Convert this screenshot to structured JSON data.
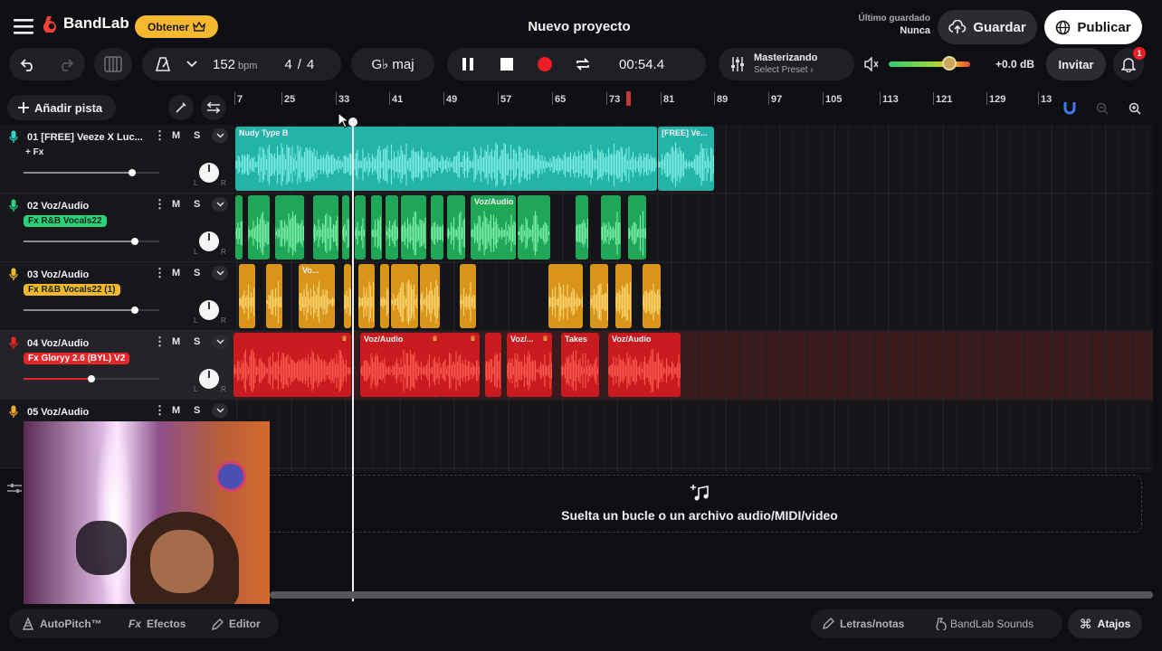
{
  "header": {
    "brand": "BandLab",
    "get_button": "Obtener",
    "project_title": "Nuevo proyecto",
    "last_saved_label": "Último guardado",
    "last_saved_value": "Nunca",
    "save_button": "Guardar",
    "publish_button": "Publicar"
  },
  "transport": {
    "tempo": "152",
    "tempo_unit": "bpm",
    "time_sig_num": "4",
    "time_sig_sep": "/",
    "time_sig_den": "4",
    "key": "G♭ maj",
    "time": "00:54.4",
    "mastering_title": "Masterizando",
    "mastering_sub": "Select Preset ›",
    "volume_db": "+0.0 dB",
    "invite_button": "Invitar",
    "notification_count": "1",
    "volume_level": 0.74
  },
  "toolbar": {
    "add_track": "Añadir pista"
  },
  "ruler": {
    "marks": [
      "7",
      "25",
      "33",
      "41",
      "49",
      "57",
      "65",
      "73",
      "81",
      "89",
      "97",
      "105",
      "113",
      "121",
      "129",
      "13"
    ]
  },
  "tracks": [
    {
      "name": "01  [FREE] Veeze X Luc...",
      "fx": "+ Fx",
      "color": "#2ed8c7",
      "mute": "M",
      "solo": "S",
      "volume": 0.8
    },
    {
      "name": "02  Voz/Audio",
      "fx": "Fx R&B Vocals22",
      "color": "#2cd27a",
      "mute": "M",
      "solo": "S",
      "volume": 0.82
    },
    {
      "name": "03  Voz/Audio",
      "fx": "Fx R&B Vocals22 (1)",
      "color": "#f2b72b",
      "mute": "M",
      "solo": "S",
      "volume": 0.82
    },
    {
      "name": "04  Voz/Audio",
      "fx": "Fx Gloryy 2.6 (BYL) V2",
      "color": "#e8262a",
      "mute": "M",
      "solo": "S",
      "volume": 0.5
    },
    {
      "name": "05  Voz/Audio",
      "fx": "",
      "color": "#f2a82b",
      "mute": "M",
      "solo": "S",
      "volume": 0.8
    }
  ],
  "clips": {
    "t1a": "Nudy Type B",
    "t1b": "[FREE] Ve...",
    "t2a": "Voz/Audio",
    "t3a": "Vo...",
    "t4a": "Voz/Audio",
    "t4b": "Voz/...",
    "t4c": "Takes",
    "t4d": "Voz/Audio"
  },
  "dropzone": {
    "text": "Suelta un bucle o un archivo audio/MIDI/video"
  },
  "bottom": {
    "autopitch": "AutoPitch™",
    "effects": "Efectos",
    "editor": "Editor",
    "lyrics": "Letras/notas",
    "sounds": "BandLab Sounds",
    "shortcuts": "Atajos"
  },
  "colors": {
    "accent_yellow": "#f5b82e",
    "teal": "#2ed8c7",
    "green": "#2cd27a",
    "orange": "#f2b72b",
    "red": "#e8262a",
    "brand_red": "#f0403a"
  }
}
